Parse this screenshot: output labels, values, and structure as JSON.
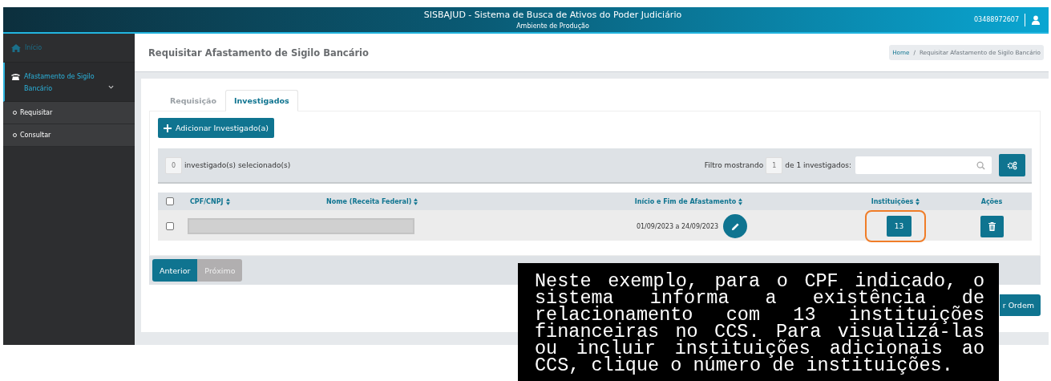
{
  "header": {
    "title": "SISBAJUD - Sistema de Busca de Ativos do Poder Judiciário",
    "subtitle": "Ambiente de Produção",
    "user_id": "03488972607"
  },
  "sidebar": {
    "items": [
      {
        "label": "Início",
        "kind": "home",
        "selected": false
      },
      {
        "label": "Afastamento de Sigilo Bancário",
        "kind": "group",
        "selected": true,
        "expanded": true,
        "children": [
          {
            "label": "Requisitar"
          },
          {
            "label": "Consultar"
          }
        ]
      }
    ]
  },
  "page_title": "Requisitar Afastamento de Sigilo Bancário",
  "breadcrumb": [
    "Home",
    "Requisitar Afastamento de Sigilo Bancário"
  ],
  "breadcrumb_separator": "/",
  "tabs": [
    {
      "label": "Requisição",
      "selected": false
    },
    {
      "label": "Investigados",
      "selected": true
    }
  ],
  "add_button": "Adicionar Investigado(a)",
  "selection": {
    "count": "0",
    "label": "investigado(s) selecionado(s)"
  },
  "filter": {
    "prefix": "Filtro mostrando",
    "count": "1",
    "suffix": "de 1 investigados:"
  },
  "table": {
    "header_checked": false,
    "columns": [
      {
        "label": "CPF/CNPJ",
        "sortable": true
      },
      {
        "label": "Nome (Receita Federal)",
        "sortable": true
      },
      {
        "label": "Início e Fim de Afastamento",
        "sortable": true
      },
      {
        "label": "Instituições",
        "sortable": true
      },
      {
        "label": "Ações",
        "sortable": false
      }
    ],
    "rows": [
      {
        "checked": false,
        "period": "01/09/2023 a 24/09/2023",
        "institutions": "13",
        "highlighted": true
      }
    ]
  },
  "pagination": [
    {
      "label": "Anterior",
      "disabled": false
    },
    {
      "label": "Próximo",
      "disabled": true
    }
  ],
  "order_button": "r Ordem",
  "callout": "Neste exemplo, para o CPF indicado, o sistema informa a existência de relacionamento com 13 instituições financeiras no CCS. Para visualizá-las ou incluir instituições adicionais ao CCS, clique o número de instituições."
}
